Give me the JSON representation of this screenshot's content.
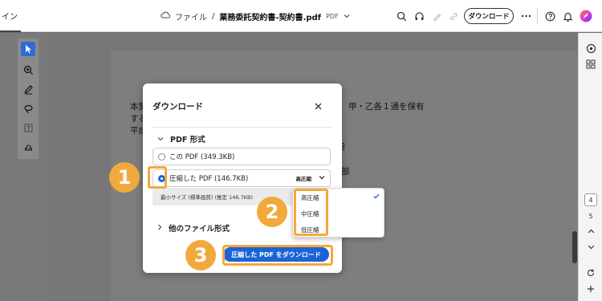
{
  "toolbar": {
    "left_tab_fragment": "イン",
    "breadcrumb_root": "ファイル",
    "breadcrumb_sep": "/",
    "file_name": "業務委託契約書-契約書.pdf",
    "file_type": "PDF",
    "download_label": "ダウンロード"
  },
  "document": {
    "line1_left": "本契",
    "line1_right": "甲・乙各１通を保有",
    "line2_left": "する",
    "line3_left": "平成",
    "right_char_a": "日",
    "right_char_b": "部",
    "bottom_char": "E"
  },
  "right_rail": {
    "page_current": "4",
    "page_prev": "5",
    "page_next": "6"
  },
  "dialog": {
    "title": "ダウンロード",
    "section_pdf": "PDF 形式",
    "option_original": "この PDF (349.3KB)",
    "option_compressed": "圧縮した PDF (146.7KB)",
    "compression_level": "高圧縮",
    "compressed_note": "最小サイズ (標準画質) (推定 146.7KB)",
    "section_other": "他のファイル形式",
    "action_label": "圧縮した PDF をダウンロード"
  },
  "dropdown": {
    "options": [
      "高圧縮",
      "中圧縮",
      "低圧縮"
    ],
    "selected": "高圧縮"
  },
  "steps": [
    "1",
    "2",
    "3"
  ],
  "colors": {
    "accent": "#1a64d6",
    "highlight": "#f2a93b",
    "overlay": "#6d6d6d"
  }
}
